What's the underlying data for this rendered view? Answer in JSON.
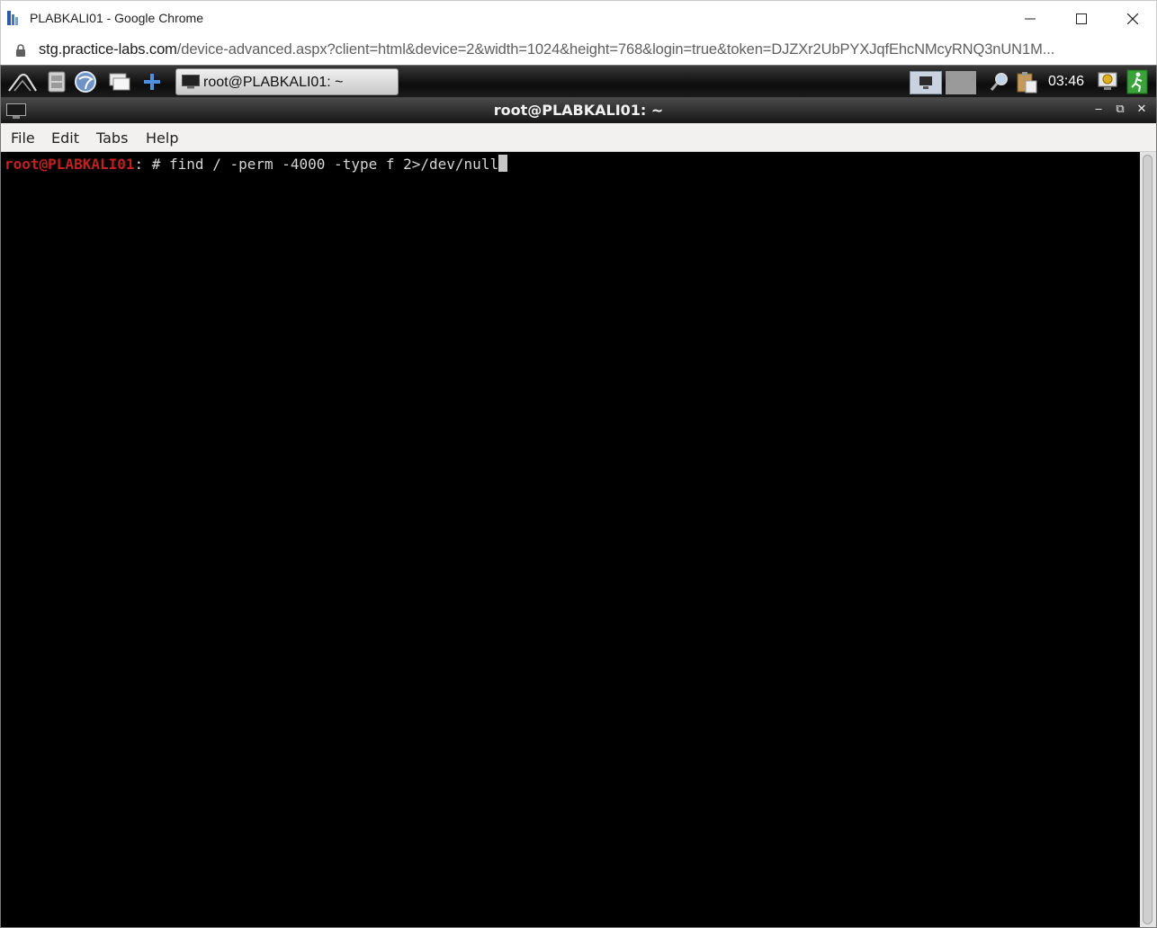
{
  "chrome": {
    "window_title": "PLABKALI01 - Google Chrome",
    "url_host": "stg.practice-labs.com",
    "url_path": "/device-advanced.aspx?client=html&device=2&width=1024&height=768&login=true&token=DJZXr2UbPYXJqfEhcNMcyRNQ3nUN1M..."
  },
  "taskbar": {
    "task_button_label": "root@PLABKALI01: ~",
    "clock": "03:46",
    "icons": [
      "kali-menu-icon",
      "file-manager-icon",
      "browser-icon",
      "show-desktop-icon",
      "add-icon"
    ]
  },
  "terminal": {
    "title": "root@PLABKALI01: ~",
    "menu": [
      "File",
      "Edit",
      "Tabs",
      "Help"
    ],
    "prompt_user": "root@PLABKALI01",
    "prompt_sep": ": # ",
    "command": "find / -perm -4000 -type f 2>/dev/null"
  },
  "colors": {
    "prompt": "#c21f1f",
    "terminal_bg": "#000000",
    "terminal_fg": "#d6d6d6"
  }
}
